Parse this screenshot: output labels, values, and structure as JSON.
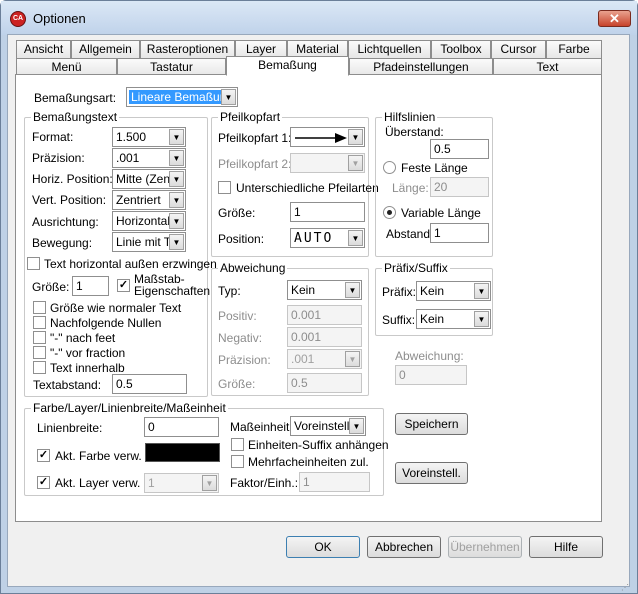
{
  "window": {
    "title": "Optionen",
    "close_label": "✕",
    "app_icon_label": "CA"
  },
  "tabs_row1": [
    "Ansicht",
    "Allgemein",
    "Rasteroptionen",
    "Layer",
    "Material",
    "Lichtquellen",
    "Toolbox",
    "Cursor",
    "Farbe"
  ],
  "tabs_row2": [
    "Menü",
    "Tastatur",
    "Bemaßung",
    "Pfadeinstellungen",
    "Text"
  ],
  "type": {
    "label": "Bemaßungsart:",
    "value": "Lineare Bemaßung"
  },
  "text_group": {
    "title": "Bemaßungstext",
    "format_label": "Format:",
    "format_value": "1.500",
    "precision_label": "Präzision:",
    "precision_value": ".001",
    "hpos_label": "Horiz. Position:",
    "hpos_value": "Mitte (Zentr",
    "vpos_label": "Vert. Position:",
    "vpos_value": "Zentriert",
    "align_label": "Ausrichtung:",
    "align_value": "Horizontal",
    "move_label": "Bewegung:",
    "move_value": "Linie mit Te",
    "force_label": "Text horizontal außen erzwingen",
    "size_label": "Größe:",
    "size_value": "1",
    "scale_label": "Maßstab-Eigenschaften",
    "normal_size_label": "Größe wie normaler Text",
    "trailing_zeros_label": "Nachfolgende Nullen",
    "feet_label": "\"-\" nach feet",
    "fraction_label": "\"-\" vor fraction",
    "inside_label": "Text innerhalb",
    "spacing_label": "Textabstand:",
    "spacing_value": "0.5"
  },
  "arrow_group": {
    "title": "Pfeilkopfart",
    "head1_label": "Pfeilkopfart 1:",
    "head2_label": "Pfeilkopfart 2:",
    "different_label": "Unterschiedliche Pfeilarten",
    "size_label": "Größe:",
    "size_value": "1",
    "position_label": "Position:",
    "position_value": "AUTO"
  },
  "deviation_group": {
    "title": "Abweichung",
    "type_label": "Typ:",
    "type_value": "Kein",
    "pos_label": "Positiv:",
    "pos_value": "0.001",
    "neg_label": "Negativ:",
    "neg_value": "0.001",
    "precision_label": "Präzision:",
    "precision_value": ".001",
    "size_label": "Größe:",
    "size_value": "0.5"
  },
  "aux_group": {
    "title": "Hilfslinien",
    "overhang_label": "Überstand:",
    "overhang_value": "0.5",
    "fixed_label": "Feste Länge",
    "length_label": "Länge:",
    "length_value": "20",
    "variable_label": "Variable Länge",
    "distance_label": "Abstand:",
    "distance_value": "1"
  },
  "prefix_group": {
    "title": "Präfix/Suffix",
    "prefix_label": "Präfix:",
    "prefix_value": "Kein",
    "suffix_label": "Suffix:",
    "suffix_value": "Kein"
  },
  "dev_field": {
    "label": "Abweichung:",
    "value": "0"
  },
  "color_group": {
    "title": "Farbe/Layer/Linienbreite/Maßeinheit",
    "linewidth_label": "Linienbreite:",
    "linewidth_value": "0",
    "unit_label": "Maßeinheit:",
    "unit_value": "Voreinstellu",
    "suffix_label": "Einheiten-Suffix anhängen",
    "multi_label": "Mehrfacheinheiten zul.",
    "cur_color_label": "Akt. Farbe verw.",
    "color_value": "#000000",
    "cur_layer_label": "Akt. Layer verw.",
    "layer_value": "1",
    "factor_label": "Faktor/Einh.:",
    "factor_value": "1"
  },
  "buttons": {
    "save": "Speichern",
    "defaults": "Voreinstell.",
    "ok": "OK",
    "cancel": "Abbrechen",
    "apply": "Übernehmen",
    "help": "Hilfe"
  },
  "checkbox_mark": "✓",
  "dropdown_glyph": "▼"
}
